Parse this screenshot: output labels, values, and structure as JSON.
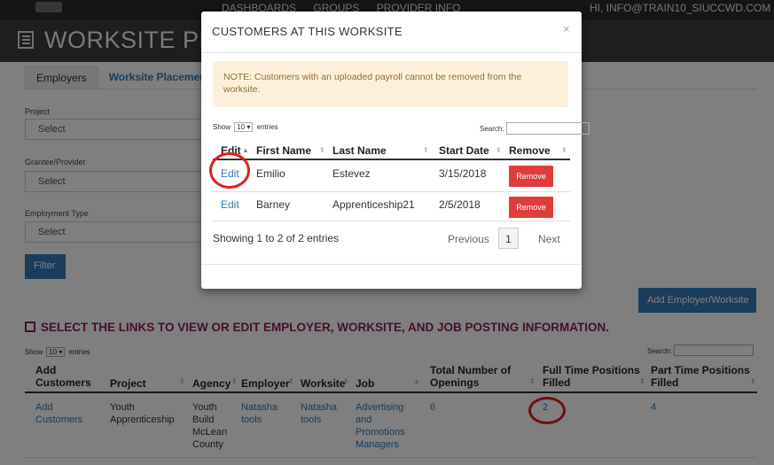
{
  "header": {
    "nav_items": [
      "DASHBOARDS",
      "GROUPS",
      "PROVIDER INFO"
    ],
    "user_label": "HI, INFO@TRAIN10_SIUCCWD.COM"
  },
  "page": {
    "title": "WORKSITE PLA"
  },
  "tabs": {
    "employers": "Employers",
    "worksite_placement": "Worksite Placement"
  },
  "filters": {
    "project_label": "Project",
    "grantee_label": "Grantee/Provider",
    "employment_type_label": "Employment Type",
    "select_placeholder": "Select",
    "filter_button": "Filter"
  },
  "actions": {
    "add_employer_worksite": "Add Employer/Worksite"
  },
  "instruction": "SELECT THE LINKS TO VIEW OR EDIT EMPLOYER, WORKSITE, AND JOB POSTING INFORMATION.",
  "bg_table": {
    "show": "Show",
    "entries_value": "10",
    "entries": "entries",
    "search_label": "Search:",
    "columns": [
      "Add Customers",
      "Project",
      "Agency",
      "Employer",
      "Worksite",
      "Job",
      "Total Number of Openings",
      "Full Time Positions Filled",
      "Part Time Positions Filled"
    ],
    "row": {
      "add_customers": "Add Customers",
      "project": "Youth Apprenticeship",
      "agency": "Youth Build McLean County",
      "employer": "Natasha tools",
      "worksite": "Natasha tools",
      "job": "Advertising and Promotions Managers",
      "total_openings": "6",
      "full_time_filled": "2",
      "part_time_filled": "4"
    }
  },
  "modal": {
    "title": "CUSTOMERS AT THIS WORKSITE",
    "close": "×",
    "note": "NOTE: Customers with an uploaded payroll cannot be removed from the worksite.",
    "show": "Show",
    "entries_value": "10",
    "entries": "entries",
    "search_label": "Search:",
    "columns": [
      "Edit",
      "First Name",
      "Last Name",
      "Start Date",
      "Remove"
    ],
    "rows": [
      {
        "edit": "Edit",
        "first_name": "Emilio",
        "last_name": "Estevez",
        "start_date": "3/15/2018",
        "remove": "Remove"
      },
      {
        "edit": "Edit",
        "first_name": "Barney",
        "last_name": "Apprenticeship21",
        "start_date": "2/5/2018",
        "remove": "Remove"
      }
    ],
    "info": "Showing 1 to 2 of 2 entries",
    "previous": "Previous",
    "page": "1",
    "next": "Next"
  },
  "colors": {
    "link": "#337ab7",
    "remove_button": "#e03c3c",
    "note_background": "#fcf0dd",
    "instruction_text": "#8a1e5a",
    "annotation_circle": "#e02020"
  }
}
